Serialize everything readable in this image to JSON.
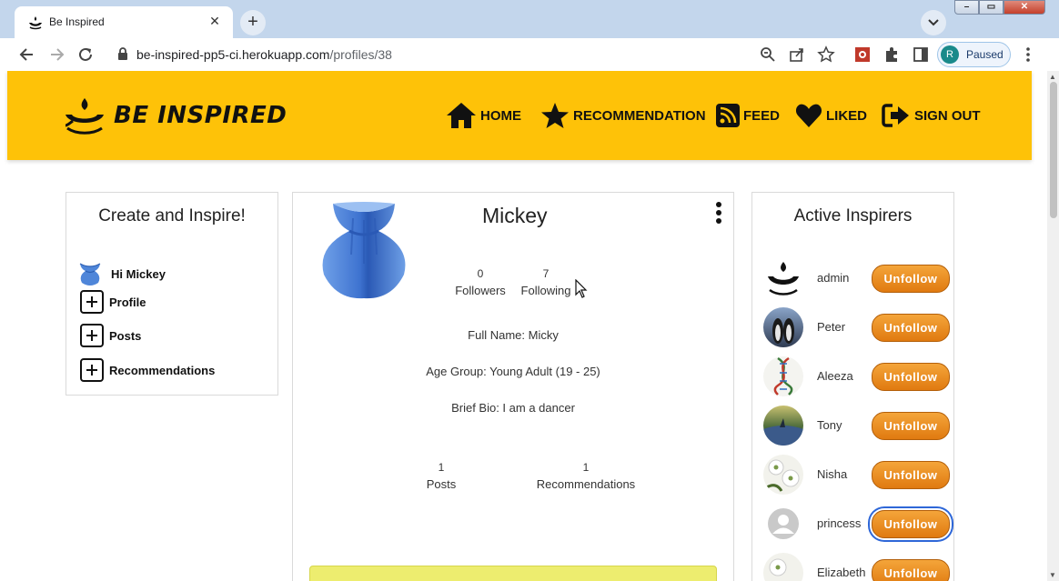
{
  "browser": {
    "tab_title": "Be Inspired",
    "tab_close": "✕",
    "new_tab": "+",
    "url_host": "be-inspired-pp5-ci.herokuapp.com",
    "url_path": "/profiles/38",
    "profile_initial": "R",
    "profile_status": "Paused"
  },
  "navbar": {
    "brand": "BE INSPIRED",
    "links": [
      {
        "label": "HOME",
        "icon": "home-icon"
      },
      {
        "label": "RECOMMENDATION",
        "icon": "star-icon"
      },
      {
        "label": "FEED",
        "icon": "rss-icon"
      },
      {
        "label": "LIKED",
        "icon": "heart-icon"
      },
      {
        "label": "SIGN OUT",
        "icon": "sign-out-icon"
      }
    ]
  },
  "sidebar": {
    "title": "Create and Inspire!",
    "greeting": "Hi Mickey",
    "links": [
      "Profile",
      "Posts",
      "Recommendations"
    ]
  },
  "profile": {
    "name": "Mickey",
    "followers_count": "0",
    "followers_label": "Followers",
    "following_count": "7",
    "following_label": "Following",
    "full_name": "Full Name: Micky",
    "age_group": "Age Group: Young Adult (19 - 25)",
    "bio": "Brief Bio: I am a dancer",
    "posts_count": "1",
    "posts_label": "Posts",
    "recommendations_count": "1",
    "recommendations_label": "Recommendations"
  },
  "inspirers": {
    "title": "Active Inspirers",
    "items": [
      {
        "name": "admin",
        "button": "Unfollow"
      },
      {
        "name": "Peter",
        "button": "Unfollow"
      },
      {
        "name": "Aleeza",
        "button": "Unfollow"
      },
      {
        "name": "Tony",
        "button": "Unfollow"
      },
      {
        "name": "Nisha",
        "button": "Unfollow"
      },
      {
        "name": "princess",
        "button": "Unfollow"
      },
      {
        "name": "Elizabeth",
        "button": "Unfollow"
      }
    ]
  },
  "colors": {
    "navbar": "#fec208",
    "button": "#e8891e",
    "highlight_bar": "#eded6f"
  }
}
